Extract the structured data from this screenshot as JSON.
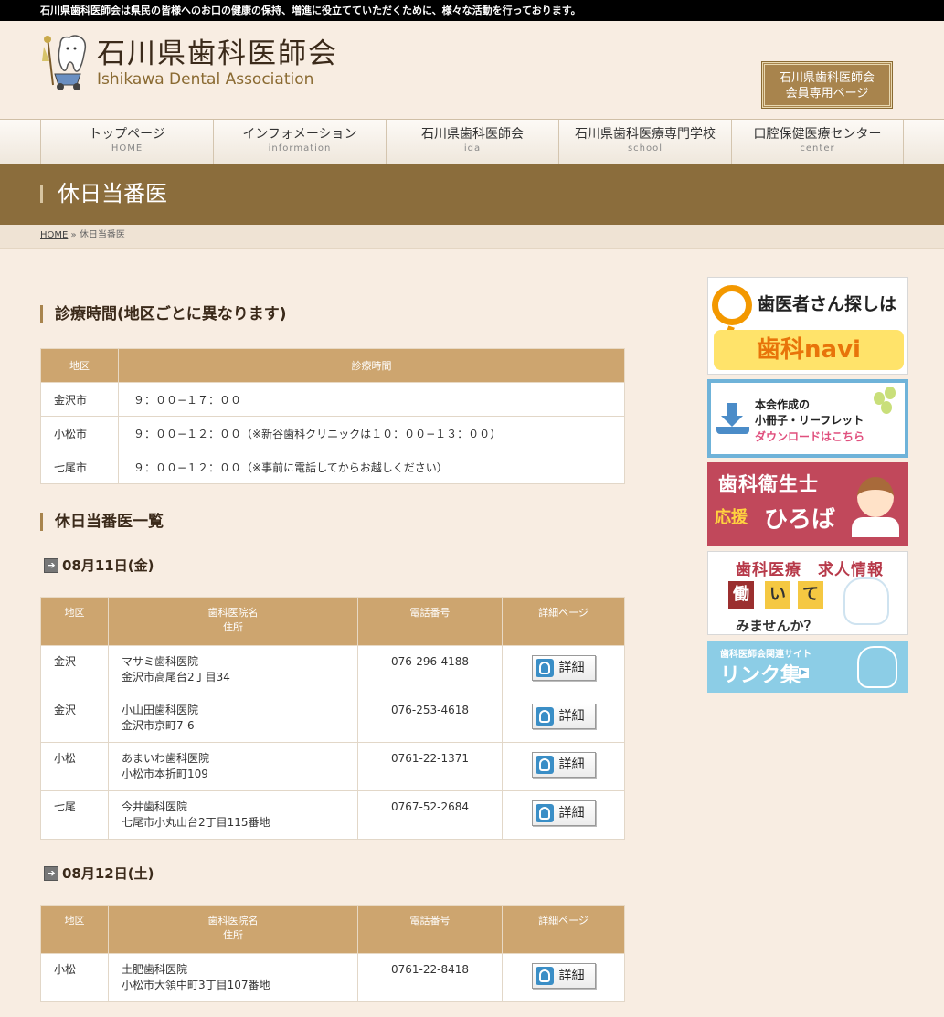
{
  "topbar": {
    "text": "石川県歯科医師会は県民の皆様へのお口の健康の保持、増進に役立てていただくために、様々な活動を行っております。"
  },
  "logo": {
    "ja": "石川県歯科医師会",
    "en": "Ishikawa Dental Association"
  },
  "member_button": {
    "line1": "石川県歯科医師会",
    "line2": "会員専用ページ"
  },
  "nav": [
    {
      "ja": "トップページ",
      "en": "HOME"
    },
    {
      "ja": "インフォメーション",
      "en": "information"
    },
    {
      "ja": "石川県歯科医師会",
      "en": "ida"
    },
    {
      "ja": "石川県歯科医療専門学校",
      "en": "school"
    },
    {
      "ja": "口腔保健医療センター",
      "en": "center"
    }
  ],
  "page_title": "休日当番医",
  "breadcrumb": {
    "home": "HOME",
    "sep": " » ",
    "current": "休日当番医"
  },
  "hours_section": {
    "heading": "診療時間(地区ごとに異なります)",
    "headers": [
      "地区",
      "診療時間"
    ],
    "rows": [
      [
        "金沢市",
        "９：００−１７：００"
      ],
      [
        "小松市",
        "９：００−１２：００（※新谷歯科クリニックは１０：００−１３：００）"
      ],
      [
        "七尾市",
        "９：００−１２：００（※事前に電話してからお越しください）"
      ]
    ]
  },
  "list_section": {
    "heading": "休日当番医一覧"
  },
  "duty_headers": {
    "area": "地区",
    "clinic": "歯科医院名",
    "address": "住所",
    "tel": "電話番号",
    "detail": "詳細ページ"
  },
  "detail_label": "詳細",
  "days": [
    {
      "date": "08月11日(金)",
      "rows": [
        {
          "area": "金沢",
          "clinic": "マサミ歯科医院",
          "address": "金沢市高尾台2丁目34",
          "tel": "076-296-4188"
        },
        {
          "area": "金沢",
          "clinic": "小山田歯科医院",
          "address": "金沢市京町7-6",
          "tel": "076-253-4618"
        },
        {
          "area": "小松",
          "clinic": "あまいわ歯科医院",
          "address": "小松市本折町109",
          "tel": "0761-22-1371"
        },
        {
          "area": "七尾",
          "clinic": "今井歯科医院",
          "address": "七尾市小丸山台2丁目115番地",
          "tel": "0767-52-2684"
        }
      ]
    },
    {
      "date": "08月12日(土)",
      "rows": [
        {
          "area": "小松",
          "clinic": "土肥歯科医院",
          "address": "小松市大領中町3丁目107番地",
          "tel": "0761-22-8418"
        }
      ]
    }
  ],
  "sidebar": {
    "navi": {
      "line1": "歯医者さん探しは",
      "line2": "歯科navi"
    },
    "leaflet": {
      "line1": "本会作成の",
      "line2": "小冊子・リーフレット",
      "line3": "ダウンロードはこちら"
    },
    "hygienist": {
      "line1": "歯科衛生士",
      "line2": "応援",
      "line3": "ひろば"
    },
    "jobs": {
      "line1": "歯科医療　求人情報",
      "k1": "働",
      "k2": "い",
      "k3": "て",
      "line2": "みませんか？"
    },
    "links": {
      "line1": "歯科医師会関連サイト",
      "line2": "リンク集"
    }
  },
  "colors": {
    "accent": "#8b6d3c",
    "table_header": "#cda56f",
    "background": "#f8ede2"
  }
}
